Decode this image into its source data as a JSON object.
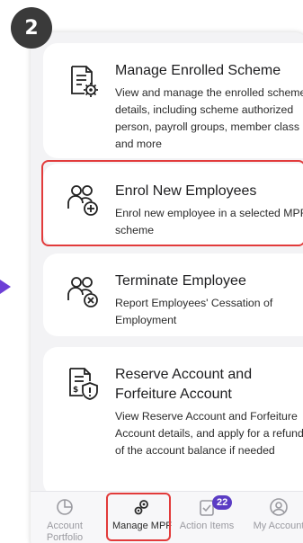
{
  "step_badge": "2",
  "cards": [
    {
      "title": "Manage Enrolled Scheme",
      "description": "View and manage the enrolled scheme's details, including scheme authorized person, payroll groups, member class and more",
      "icon": "document-gear-icon"
    },
    {
      "title": "Enrol New Employees",
      "description": "Enrol new employee in a selected MPF scheme",
      "icon": "users-add-icon"
    },
    {
      "title": "Terminate Employee",
      "description": "Report Employees' Cessation of Employment",
      "icon": "users-remove-icon"
    },
    {
      "title": "Reserve Account and Forfeiture Account",
      "description": "View Reserve Account and Forfeiture Account details, and apply for a refund of the account balance if needed",
      "icon": "document-shield-dollar-icon"
    }
  ],
  "nav": {
    "account_portfolio": "Account Portfolio",
    "manage_mpf": "Manage MPF",
    "action_items": "Action Items",
    "action_items_badge": "22",
    "my_account": "My Account"
  },
  "colors": {
    "highlight": "#e23b3b",
    "badge": "#5b3cc4",
    "pointer": "#6d3fd6"
  }
}
